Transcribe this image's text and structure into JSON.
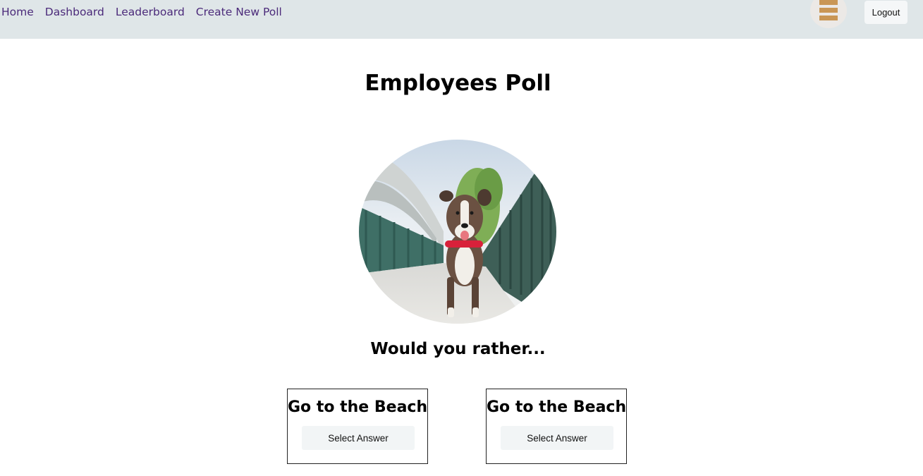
{
  "nav": {
    "links": [
      "Home",
      "Dashboard",
      "Leaderboard",
      "Create New Poll"
    ],
    "logout_label": "Logout"
  },
  "page": {
    "title": "Employees Poll"
  },
  "poll": {
    "question": "Would you rather...",
    "options": [
      {
        "text": "Go to the Beach",
        "button_label": "Select Answer"
      },
      {
        "text": "Go to the Beach",
        "button_label": "Select Answer"
      }
    ]
  },
  "colors": {
    "navbar_bg": "#dfe6e8",
    "nav_link": "#4b2a7a",
    "button_bg": "#f2f5f6"
  }
}
